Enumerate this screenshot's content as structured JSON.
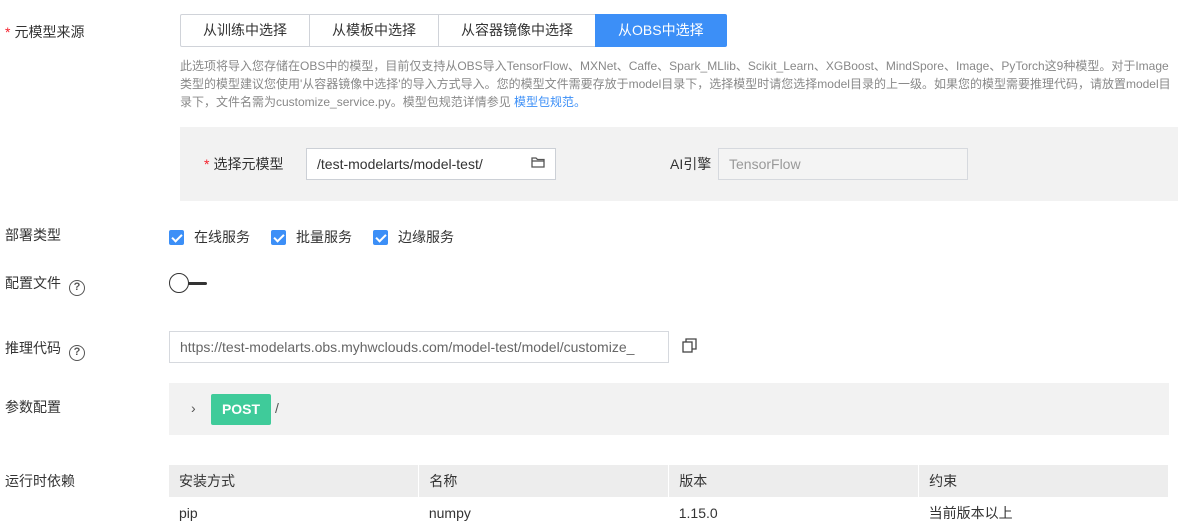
{
  "source_label": "元模型来源",
  "tabs": [
    {
      "label": "从训练中选择"
    },
    {
      "label": "从模板中选择"
    },
    {
      "label": "从容器镜像中选择"
    },
    {
      "label": "从OBS中选择"
    }
  ],
  "description": {
    "text": "此选项将导入您存储在OBS中的模型，目前仅支持从OBS导入TensorFlow、MXNet、Caffe、Spark_MLlib、Scikit_Learn、XGBoost、MindSpore、Image、PyTorch这9种模型。对于Image类型的模型建议您使用'从容器镜像中选择'的导入方式导入。您的模型文件需要存放于model目录下，选择模型时请您选择model目录的上一级。如果您的模型需要推理代码，请放置model目录下，文件名需为customize_service.py。模型包规范详情参见 ",
    "link": "模型包规范。"
  },
  "meta_model": {
    "label": "选择元模型",
    "value": "/test-modelarts/model-test/",
    "icon": "folder-icon"
  },
  "ai_engine": {
    "label": "AI引擎",
    "value": "TensorFlow"
  },
  "deploy": {
    "label": "部署类型",
    "options": [
      "在线服务",
      "批量服务",
      "边缘服务"
    ]
  },
  "config": {
    "label": "配置文件",
    "help": "?",
    "enabled": false
  },
  "inference": {
    "label": "推理代码",
    "help": "?",
    "value": "https://test-modelarts.obs.myhwclouds.com/model-test/model/customize_",
    "icon": "copy-icon"
  },
  "params": {
    "label": "参数配置",
    "method": "POST",
    "path": "/"
  },
  "runtime": {
    "label": "运行时依赖",
    "headers": [
      "安装方式",
      "名称",
      "版本",
      "约束"
    ],
    "rows": [
      [
        "pip",
        "numpy",
        "1.15.0",
        "当前版本以上"
      ]
    ]
  },
  "colors": {
    "accent": "#3c8ff7",
    "post": "#3fcb9a",
    "required": "#f5222d"
  }
}
